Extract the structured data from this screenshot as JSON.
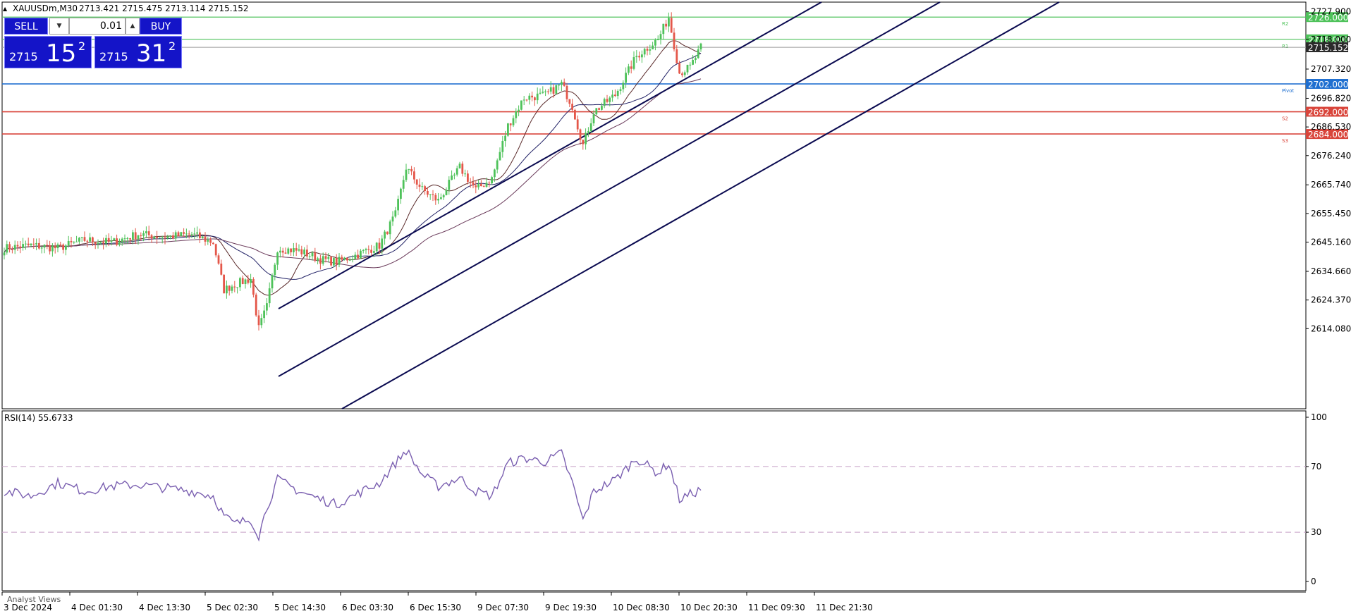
{
  "header": {
    "symbol": "XAUUSDm,M30",
    "ohlc": "2713.421 2715.475 2713.114 2715.152"
  },
  "trade_panel": {
    "sell_label": "SELL",
    "buy_label": "BUY",
    "lot": "0.01",
    "sell_price_small": "2715",
    "sell_price_big": "15",
    "sell_price_sup": "2",
    "buy_price_small": "2715",
    "buy_price_big": "31",
    "buy_price_sup": "2"
  },
  "price_axis": {
    "ticks": [
      "2727.900",
      "2718.000",
      "2707.320",
      "2696.820",
      "2686.530",
      "2676.240",
      "2665.740",
      "2655.450",
      "2645.160",
      "2634.660",
      "2624.370",
      "2614.080"
    ]
  },
  "levels": [
    {
      "price": 2726.0,
      "label": "2726.000",
      "color": "#4ec25a",
      "tag": "R2"
    },
    {
      "price": 2718.0,
      "label": "2718.000",
      "color": "#4ec25a",
      "tag": "R1"
    },
    {
      "price": 2702.0,
      "label": "2702.000",
      "color": "#1f6fd0",
      "tag": "Pivot"
    },
    {
      "price": 2692.0,
      "label": "2692.000",
      "color": "#d9453b",
      "tag": "S2"
    },
    {
      "price": 2684.0,
      "label": "2684.000",
      "color": "#d9453b",
      "tag": "S3"
    }
  ],
  "current_price": {
    "price": 2715.152,
    "label": "2715.152"
  },
  "rsi": {
    "label": "RSI(14) 55.6733",
    "ticks": [
      "100",
      "70",
      "30",
      "0"
    ]
  },
  "time_axis": {
    "labels": [
      "3 Dec 2024",
      "4 Dec 01:30",
      "4 Dec 13:30",
      "5 Dec 02:30",
      "5 Dec 14:30",
      "6 Dec 03:30",
      "6 Dec 15:30",
      "9 Dec 07:30",
      "9 Dec 19:30",
      "10 Dec 08:30",
      "10 Dec 20:30",
      "11 Dec 09:30",
      "11 Dec 21:30"
    ]
  },
  "bottom_tab": "Analyst Views",
  "colors": {
    "bull": "#4ec25a",
    "bear": "#e4574a",
    "channel": "#0a0a50",
    "rsi_line": "#7a5fb0"
  },
  "chart_data": {
    "type": "candlestick",
    "price_range": [
      2610,
      2730
    ],
    "close_anchors": [
      [
        0,
        2643
      ],
      [
        10,
        2644
      ],
      [
        20,
        2643
      ],
      [
        30,
        2646
      ],
      [
        40,
        2645
      ],
      [
        50,
        2648
      ],
      [
        60,
        2647
      ],
      [
        70,
        2648
      ],
      [
        78,
        2645
      ],
      [
        82,
        2628
      ],
      [
        86,
        2630
      ],
      [
        92,
        2632
      ],
      [
        95,
        2614
      ],
      [
        98,
        2622
      ],
      [
        102,
        2643
      ],
      [
        110,
        2642
      ],
      [
        118,
        2639
      ],
      [
        124,
        2638
      ],
      [
        130,
        2640
      ],
      [
        140,
        2644
      ],
      [
        146,
        2655
      ],
      [
        150,
        2672
      ],
      [
        156,
        2664
      ],
      [
        162,
        2660
      ],
      [
        170,
        2672
      ],
      [
        176,
        2664
      ],
      [
        182,
        2668
      ],
      [
        188,
        2687
      ],
      [
        194,
        2697
      ],
      [
        202,
        2698
      ],
      [
        208,
        2702
      ],
      [
        212,
        2694
      ],
      [
        216,
        2680
      ],
      [
        220,
        2692
      ],
      [
        228,
        2698
      ],
      [
        236,
        2712
      ],
      [
        244,
        2718
      ],
      [
        248,
        2726
      ],
      [
        252,
        2706
      ],
      [
        256,
        2708
      ],
      [
        260,
        2715
      ]
    ],
    "rsi_anchors": [
      [
        0,
        55
      ],
      [
        10,
        52
      ],
      [
        20,
        60
      ],
      [
        30,
        55
      ],
      [
        40,
        58
      ],
      [
        50,
        59
      ],
      [
        60,
        57
      ],
      [
        70,
        55
      ],
      [
        78,
        52
      ],
      [
        82,
        40
      ],
      [
        86,
        35
      ],
      [
        92,
        38
      ],
      [
        95,
        28
      ],
      [
        98,
        45
      ],
      [
        102,
        62
      ],
      [
        110,
        55
      ],
      [
        118,
        50
      ],
      [
        124,
        47
      ],
      [
        130,
        52
      ],
      [
        140,
        60
      ],
      [
        146,
        72
      ],
      [
        150,
        80
      ],
      [
        156,
        65
      ],
      [
        162,
        58
      ],
      [
        170,
        63
      ],
      [
        176,
        55
      ],
      [
        182,
        52
      ],
      [
        188,
        72
      ],
      [
        194,
        75
      ],
      [
        202,
        73
      ],
      [
        208,
        78
      ],
      [
        212,
        60
      ],
      [
        216,
        37
      ],
      [
        220,
        55
      ],
      [
        228,
        62
      ],
      [
        236,
        75
      ],
      [
        244,
        66
      ],
      [
        248,
        72
      ],
      [
        252,
        50
      ],
      [
        256,
        53
      ],
      [
        260,
        56
      ]
    ]
  }
}
